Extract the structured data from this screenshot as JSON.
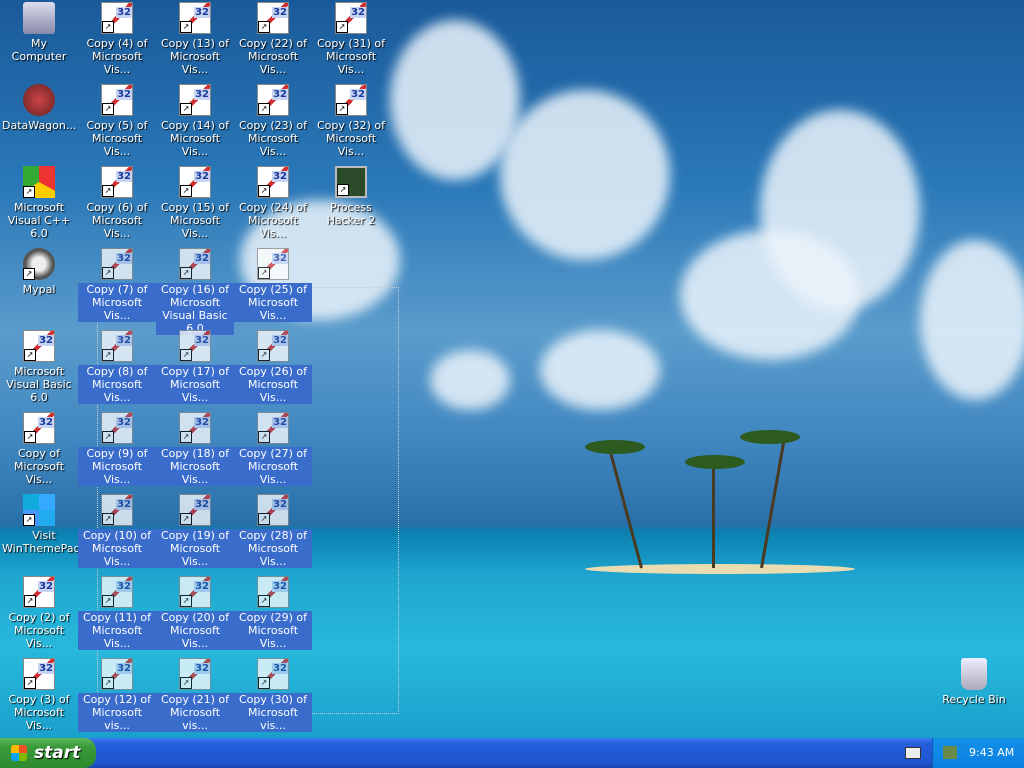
{
  "desktop": {
    "columns": [
      [
        {
          "label": "My Computer",
          "icon": "computer-icon"
        },
        {
          "label": "DataWagon...",
          "icon": "datawagon-icon"
        },
        {
          "label": "Microsoft Visual C++ 6.0",
          "icon": "visual-cpp-icon"
        },
        {
          "label": "Mypal",
          "icon": "raccoon-icon"
        },
        {
          "label": "Microsoft Visual Basic 6.0",
          "icon": "visual-basic-icon"
        },
        {
          "label": "Copy of Microsoft Vis...",
          "icon": "visual-basic-icon"
        },
        {
          "label": "Visit WinThemePack",
          "icon": "windows-icon"
        },
        {
          "label": "Copy (2) of Microsoft Vis...",
          "icon": "visual-basic-icon"
        },
        {
          "label": "Copy (3) of Microsoft Vis...",
          "icon": "visual-basic-icon"
        }
      ],
      [
        {
          "label": "Copy (4) of Microsoft Vis...",
          "icon": "visual-basic-icon"
        },
        {
          "label": "Copy (5) of Microsoft Vis...",
          "icon": "visual-basic-icon"
        },
        {
          "label": "Copy (6) of Microsoft Vis...",
          "icon": "visual-basic-icon"
        },
        {
          "label": "Copy (7) of Microsoft Vis...",
          "icon": "visual-basic-icon",
          "selected": true
        },
        {
          "label": "Copy (8) of Microsoft Vis...",
          "icon": "visual-basic-icon",
          "selected": true
        },
        {
          "label": "Copy (9) of Microsoft Vis...",
          "icon": "visual-basic-icon",
          "selected": true
        },
        {
          "label": "Copy (10) of Microsoft Vis...",
          "icon": "visual-basic-icon",
          "selected": true
        },
        {
          "label": "Copy (11) of Microsoft Vis...",
          "icon": "visual-basic-icon",
          "selected": true
        },
        {
          "label": "Copy (12) of Microsoft vis...",
          "icon": "visual-basic-icon",
          "selected": true
        }
      ],
      [
        {
          "label": "Copy (13) of Microsoft Vis...",
          "icon": "visual-basic-icon"
        },
        {
          "label": "Copy (14) of Microsoft Vis...",
          "icon": "visual-basic-icon"
        },
        {
          "label": "Copy (15) of Microsoft Vis...",
          "icon": "visual-basic-icon"
        },
        {
          "label": "Copy (16) of Microsoft Visual Basic 6.0",
          "icon": "visual-basic-icon",
          "selected": true
        },
        {
          "label": "Copy (17) of Microsoft Vis...",
          "icon": "visual-basic-icon",
          "selected": true
        },
        {
          "label": "Copy (18) of Microsoft Vis...",
          "icon": "visual-basic-icon",
          "selected": true
        },
        {
          "label": "Copy (19) of Microsoft Vis...",
          "icon": "visual-basic-icon",
          "selected": true
        },
        {
          "label": "Copy (20) of Microsoft Vis...",
          "icon": "visual-basic-icon",
          "selected": true
        },
        {
          "label": "Copy (21) of Microsoft vis...",
          "icon": "visual-basic-icon",
          "selected": true
        }
      ],
      [
        {
          "label": "Copy (22) of Microsoft Vis...",
          "icon": "visual-basic-icon"
        },
        {
          "label": "Copy (23) of Microsoft Vis...",
          "icon": "visual-basic-icon"
        },
        {
          "label": "Copy (24) of Microsoft Vis...",
          "icon": "visual-basic-icon"
        },
        {
          "label": "Copy (25) of Microsoft Vis...",
          "icon": "visual-basic-icon",
          "selected": true
        },
        {
          "label": "Copy (26) of Microsoft Vis...",
          "icon": "visual-basic-icon",
          "selected": true
        },
        {
          "label": "Copy (27) of Microsoft Vis...",
          "icon": "visual-basic-icon",
          "selected": true
        },
        {
          "label": "Copy (28) of Microsoft Vis...",
          "icon": "visual-basic-icon",
          "selected": true
        },
        {
          "label": "Copy (29) of Microsoft Vis...",
          "icon": "visual-basic-icon",
          "selected": true
        },
        {
          "label": "Copy (30) of Microsoft vis...",
          "icon": "visual-basic-icon",
          "selected": true
        }
      ],
      [
        {
          "label": "Copy (31) of Microsoft Vis...",
          "icon": "visual-basic-icon"
        },
        {
          "label": "Copy (32) of Microsoft Vis...",
          "icon": "visual-basic-icon"
        },
        {
          "label": "Process Hacker 2",
          "icon": "process-hacker-icon"
        }
      ]
    ],
    "recycle_bin": "Recycle Bin"
  },
  "taskbar": {
    "start_label": "start",
    "clock": "9:43 AM",
    "accent": "#245edb"
  }
}
